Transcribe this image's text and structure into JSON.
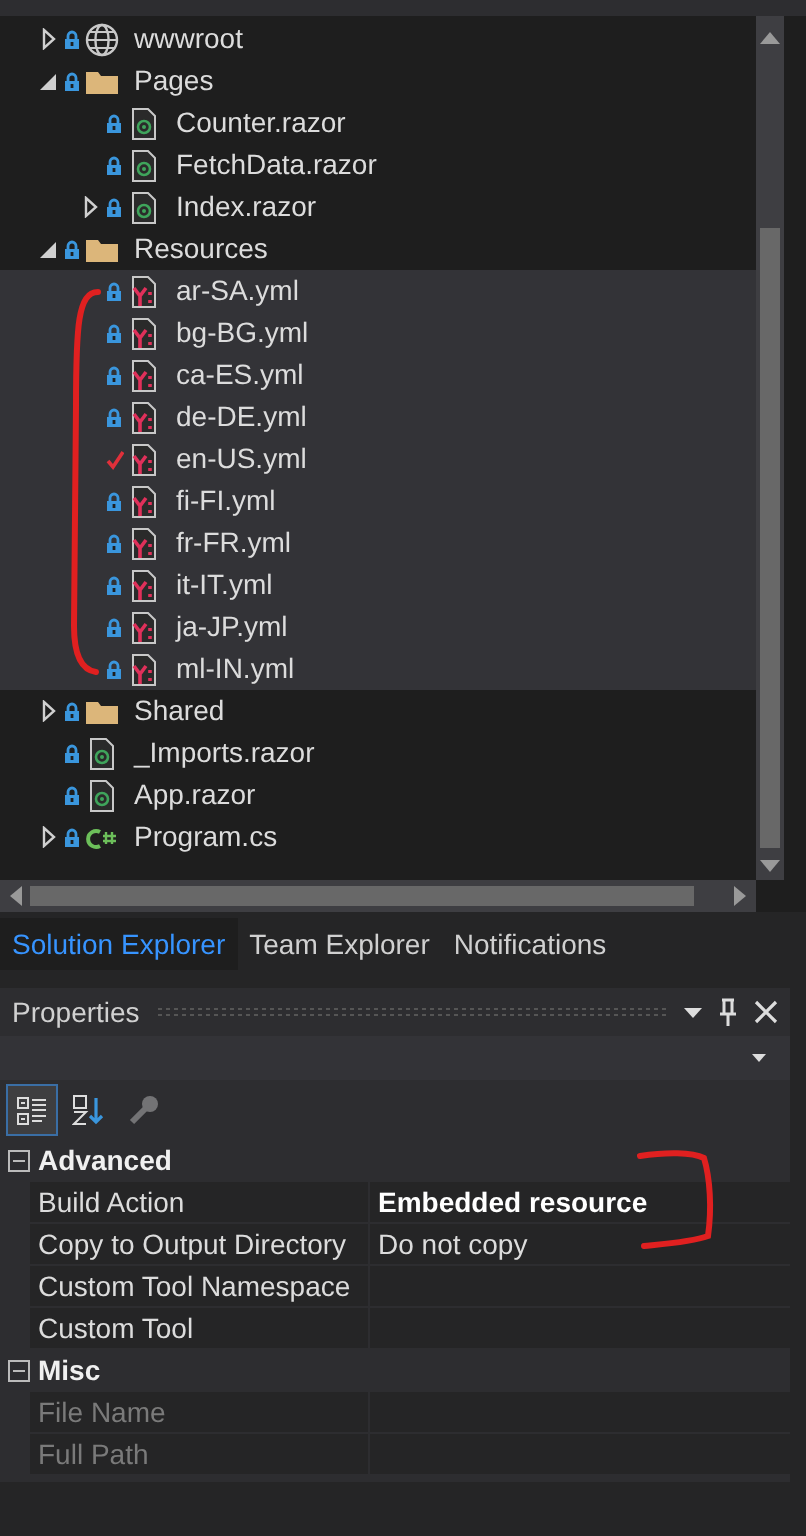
{
  "solution_explorer": {
    "tree": [
      {
        "label": "wwwroot",
        "kind": "globe",
        "checked_out": false,
        "expanded": false,
        "selected": false
      },
      {
        "label": "Pages",
        "kind": "folder",
        "checked_out": false,
        "expanded": true,
        "selected": false,
        "children": [
          {
            "label": "Counter.razor",
            "kind": "razor",
            "checked_out": false,
            "selected": false
          },
          {
            "label": "FetchData.razor",
            "kind": "razor",
            "checked_out": false,
            "selected": false
          },
          {
            "label": "Index.razor",
            "kind": "razor",
            "checked_out": false,
            "expanded": false,
            "selected": false
          }
        ]
      },
      {
        "label": "Resources",
        "kind": "folder",
        "checked_out": false,
        "expanded": true,
        "selected": false,
        "children": [
          {
            "label": "ar-SA.yml",
            "kind": "yaml",
            "checked_out": false,
            "selected": true
          },
          {
            "label": "bg-BG.yml",
            "kind": "yaml",
            "checked_out": false,
            "selected": true
          },
          {
            "label": "ca-ES.yml",
            "kind": "yaml",
            "checked_out": false,
            "selected": true
          },
          {
            "label": "de-DE.yml",
            "kind": "yaml",
            "checked_out": false,
            "selected": true
          },
          {
            "label": "en-US.yml",
            "kind": "yaml",
            "checked_out": true,
            "selected": true
          },
          {
            "label": "fi-FI.yml",
            "kind": "yaml",
            "checked_out": false,
            "selected": true
          },
          {
            "label": "fr-FR.yml",
            "kind": "yaml",
            "checked_out": false,
            "selected": true
          },
          {
            "label": "it-IT.yml",
            "kind": "yaml",
            "checked_out": false,
            "selected": true
          },
          {
            "label": "ja-JP.yml",
            "kind": "yaml",
            "checked_out": false,
            "selected": true
          },
          {
            "label": "ml-IN.yml",
            "kind": "yaml",
            "checked_out": false,
            "selected": true
          }
        ]
      },
      {
        "label": "Shared",
        "kind": "folder",
        "checked_out": false,
        "expanded": false,
        "selected": false
      },
      {
        "label": "_Imports.razor",
        "kind": "razor",
        "checked_out": false,
        "selected": false
      },
      {
        "label": "App.razor",
        "kind": "razor",
        "checked_out": false,
        "selected": false
      },
      {
        "label": "Program.cs",
        "kind": "csharp",
        "checked_out": false,
        "expanded": false,
        "selected": false
      }
    ]
  },
  "tabs": [
    {
      "label": "Solution Explorer",
      "selected": true
    },
    {
      "label": "Team Explorer",
      "selected": false
    },
    {
      "label": "Notifications",
      "selected": false
    }
  ],
  "properties": {
    "title": "Properties",
    "toolbar": [
      {
        "kind": "categorized",
        "selected": true,
        "disabled": false
      },
      {
        "kind": "alphabetical",
        "selected": false,
        "disabled": false
      },
      {
        "kind": "property-pages",
        "selected": false,
        "disabled": true
      }
    ],
    "categories": [
      {
        "name": "Advanced",
        "expanded": true,
        "rows": [
          {
            "label": "Build Action",
            "value": "Embedded resource",
            "modified": true,
            "disabled": false
          },
          {
            "label": "Copy to Output Directory",
            "value": "Do not copy",
            "modified": false,
            "disabled": false
          },
          {
            "label": "Custom Tool Namespace",
            "modified": false,
            "disabled": false
          },
          {
            "label": "Custom Tool",
            "modified": false,
            "disabled": false
          }
        ]
      },
      {
        "name": "Misc",
        "expanded": true,
        "rows": [
          {
            "label": "File Name",
            "modified": false,
            "disabled": true
          },
          {
            "label": "Full Path",
            "modified": false,
            "disabled": true
          }
        ]
      }
    ]
  }
}
